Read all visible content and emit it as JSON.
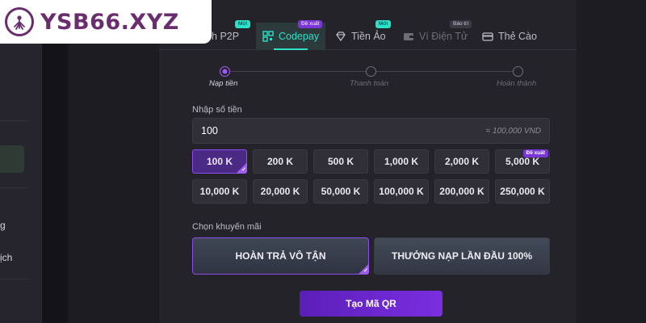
{
  "logo": {
    "text": "YSB66.XYZ"
  },
  "sidebar": {
    "items": [
      {
        "label": "g"
      },
      {
        "label": "ịch"
      }
    ]
  },
  "tabs": [
    {
      "label": "ịch P2P",
      "badge": "Mới",
      "icon": "swap-icon"
    },
    {
      "label": "Codepay",
      "badge": "Đề xuất",
      "icon": "qr-icon"
    },
    {
      "label": "Tiền Ảo",
      "badge": "Mới",
      "icon": "diamond-icon"
    },
    {
      "label": "Ví Điện Tử",
      "badge": "Bảo trì",
      "icon": "wallet-icon"
    },
    {
      "label": "Thẻ Cào",
      "badge": "",
      "icon": "card-icon"
    }
  ],
  "stepper": {
    "steps": [
      {
        "label": "Nạp tiền",
        "active": true
      },
      {
        "label": "Thanh toán",
        "active": false
      },
      {
        "label": "Hoàn thành",
        "active": false
      }
    ]
  },
  "amount": {
    "label": "Nhập số tiền",
    "value": "100",
    "converted": "= 100,000 VND"
  },
  "amount_options": [
    {
      "label": "100 K",
      "selected": true,
      "badge": ""
    },
    {
      "label": "200 K",
      "selected": false,
      "badge": ""
    },
    {
      "label": "500 K",
      "selected": false,
      "badge": ""
    },
    {
      "label": "1,000 K",
      "selected": false,
      "badge": ""
    },
    {
      "label": "2,000 K",
      "selected": false,
      "badge": ""
    },
    {
      "label": "5,000 K",
      "selected": false,
      "badge": "Đề xuất"
    },
    {
      "label": "10,000 K",
      "selected": false,
      "badge": ""
    },
    {
      "label": "20,000 K",
      "selected": false,
      "badge": ""
    },
    {
      "label": "50,000 K",
      "selected": false,
      "badge": ""
    },
    {
      "label": "100,000 K",
      "selected": false,
      "badge": ""
    },
    {
      "label": "200,000 K",
      "selected": false,
      "badge": ""
    },
    {
      "label": "250,000 K",
      "selected": false,
      "badge": ""
    }
  ],
  "promo": {
    "label": "Chọn khuyến mãi",
    "options": [
      {
        "label": "HOÀN TRẢ VÔ TẬN",
        "selected": true
      },
      {
        "label": "THƯỞNG NẠP LẦN ĐẦU 100%",
        "selected": false
      }
    ]
  },
  "submit": {
    "label": "Tạo Mã QR"
  },
  "colors": {
    "accent_teal": "#2de0c8",
    "accent_purple": "#8b4cf0",
    "brand": "#6a2d6e",
    "background": "#1d1c22"
  }
}
